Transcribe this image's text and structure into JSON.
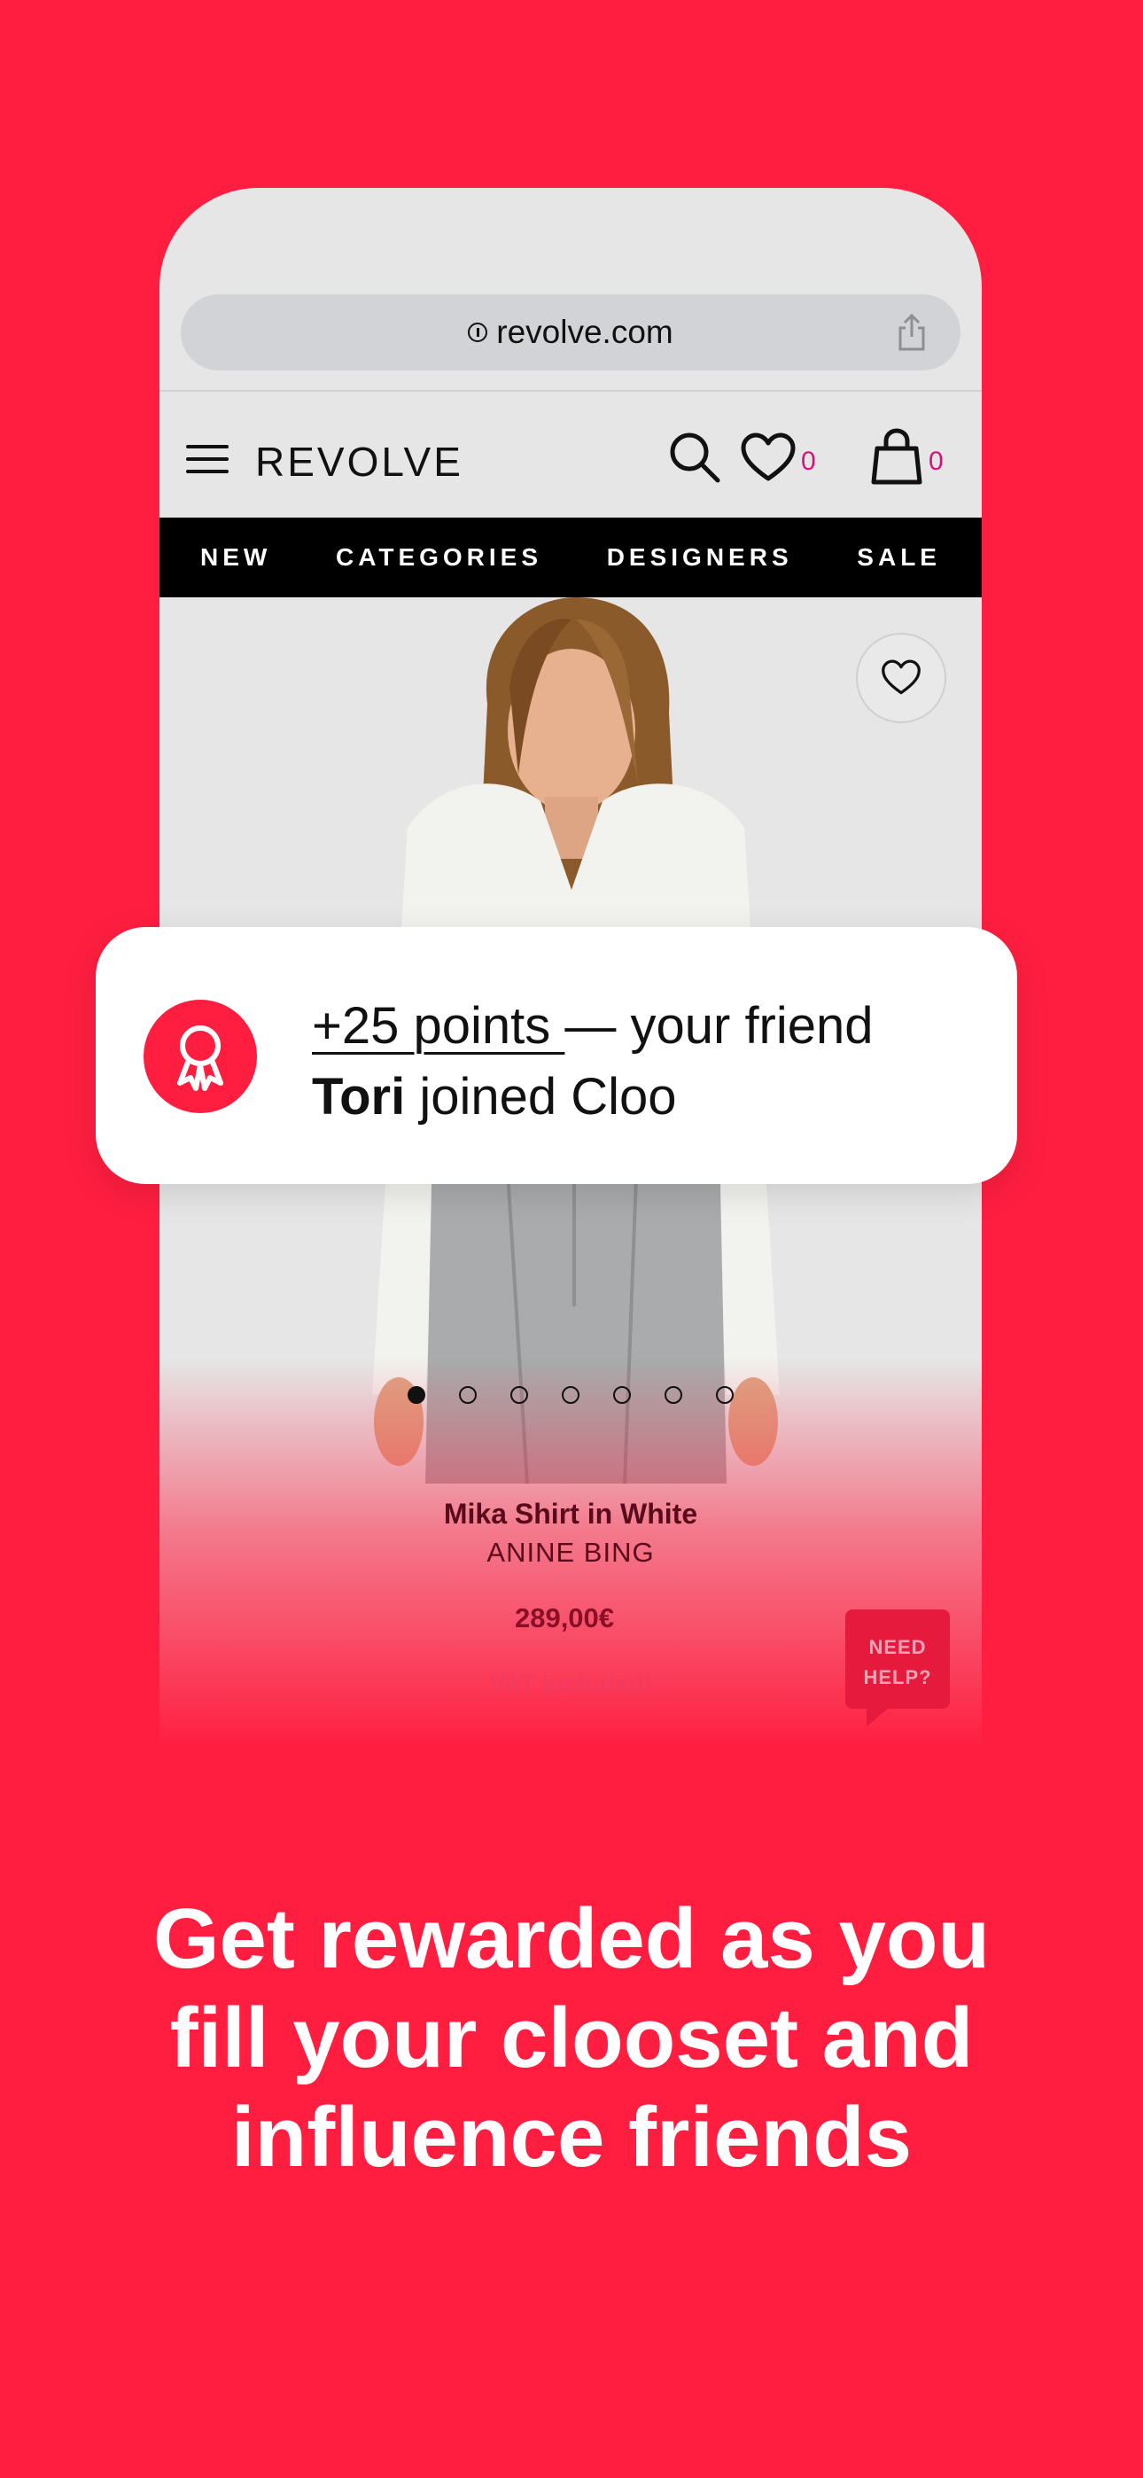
{
  "browser": {
    "url": "revolve.com"
  },
  "site": {
    "logo": "REVOLVE",
    "wishlist_count": "0",
    "bag_count": "0",
    "nav": [
      "NEW",
      "CATEGORIES",
      "DESIGNERS",
      "SALE"
    ]
  },
  "product": {
    "name": "Mika Shirt in White",
    "brand": "ANINE BING",
    "price": "289,00€",
    "vat_note": "VAT included!",
    "image_count": 7,
    "active_image": 1,
    "help_line1": "NEED",
    "help_line2": "HELP?"
  },
  "notification": {
    "points": "+25 points ",
    "rest_line1": "— your friend",
    "friend_name": "Tori",
    "rest_line2": " joined Cloo",
    "icon": "award-ribbon-icon"
  },
  "headline": {
    "line1": "Get rewarded as you",
    "line2": "fill your clooset and",
    "line3": "influence friends"
  },
  "colors": {
    "brand_red": "#FF1E40",
    "count_magenta": "#D4147A"
  }
}
